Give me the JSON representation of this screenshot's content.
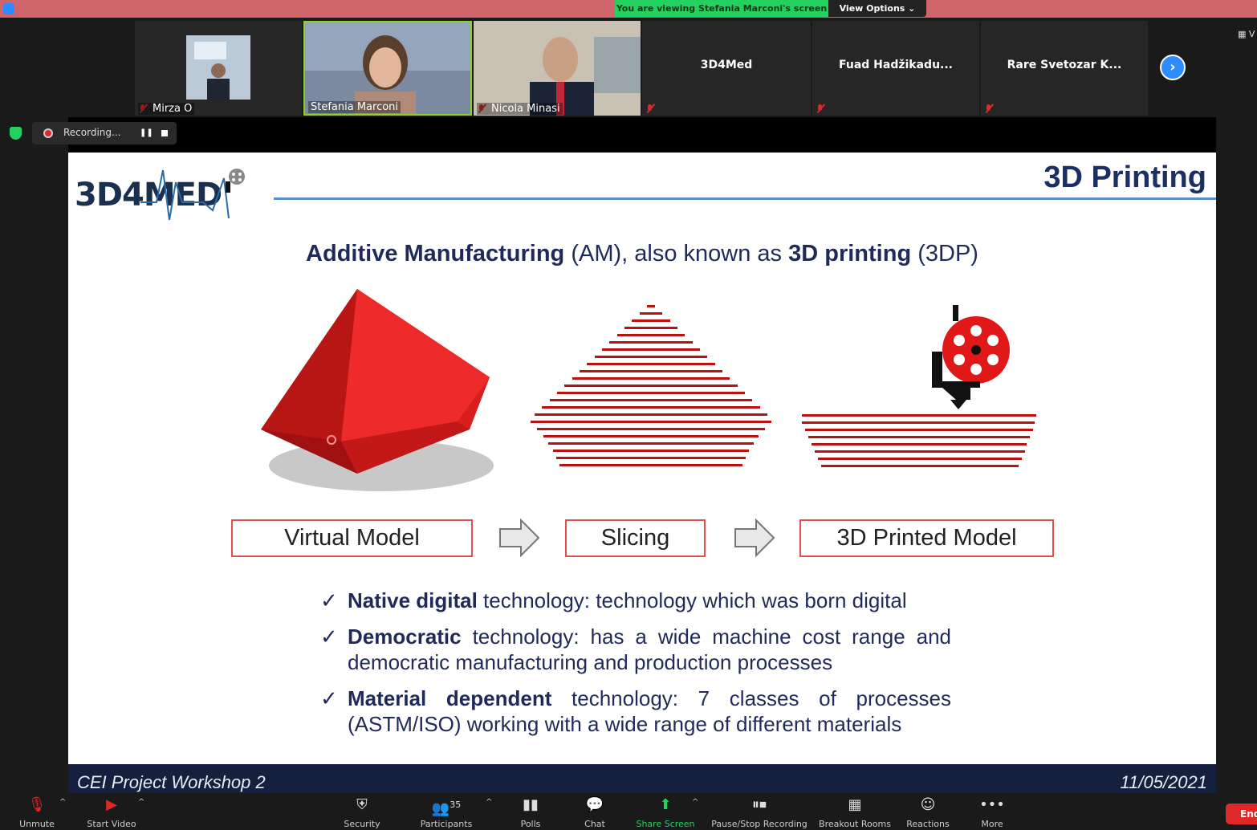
{
  "banner": {
    "viewing_text": "You are viewing Stefania Marconi's screen",
    "view_options": "View Options ⌄"
  },
  "participants_strip": [
    {
      "name": "Mirza O",
      "muted": true
    },
    {
      "name": "Stefania Marconi",
      "muted": false
    },
    {
      "name": "Nicola Minasi",
      "muted": true
    },
    {
      "name": "3D4Med",
      "muted": true
    },
    {
      "name": "Fuad  Hadžikadu...",
      "muted": true
    },
    {
      "name": "Rare Svetozar K...",
      "muted": true
    }
  ],
  "recording": {
    "label": "Recording...",
    "pause": "❚❚"
  },
  "slide": {
    "logo": "3D4MED",
    "title": "3D Printing",
    "heading_parts": [
      "Additive Manufacturing",
      " (AM), also known as ",
      "3D printing",
      " (3DP)"
    ],
    "stages": [
      "Virtual Model",
      "Slicing",
      "3D Printed Model"
    ],
    "bullets": [
      {
        "bold": "Native digital",
        "rest": " technology: technology which was born digital"
      },
      {
        "bold": "Democratic",
        "rest": " technology: has a wide machine cost range and democratic manufacturing and production processes"
      },
      {
        "bold": "Material dependent",
        "rest": " technology: 7 classes of processes (ASTM/ISO) working with a wide range of different materials"
      }
    ],
    "footer_left": "CEI Project Workshop 2",
    "footer_right": "11/05/2021"
  },
  "toolbar": {
    "unmute": "Unmute",
    "start_video": "Start Video",
    "security": "Security",
    "participants": "Participants",
    "participants_count": "35",
    "polls": "Polls",
    "chat": "Chat",
    "share_screen": "Share Screen",
    "pause_stop_recording": "Pause/Stop Recording",
    "breakout_rooms": "Breakout Rooms",
    "reactions": "Reactions",
    "more": "More",
    "end": "End"
  },
  "colors": {
    "accent_green": "#23d160",
    "zoom_blue": "#2d8cff",
    "end_red": "#e02828",
    "slide_navy": "#1f2a5a",
    "model_red": "#d91e1e"
  }
}
